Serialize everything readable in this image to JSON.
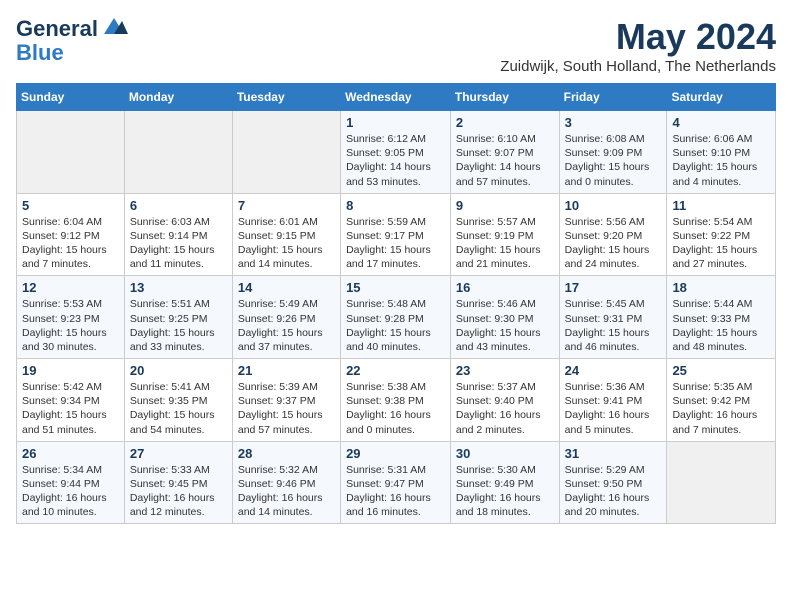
{
  "header": {
    "logo_line1": "General",
    "logo_line2": "Blue",
    "month": "May 2024",
    "location": "Zuidwijk, South Holland, The Netherlands"
  },
  "weekdays": [
    "Sunday",
    "Monday",
    "Tuesday",
    "Wednesday",
    "Thursday",
    "Friday",
    "Saturday"
  ],
  "weeks": [
    [
      {
        "num": "",
        "info": ""
      },
      {
        "num": "",
        "info": ""
      },
      {
        "num": "",
        "info": ""
      },
      {
        "num": "1",
        "info": "Sunrise: 6:12 AM\nSunset: 9:05 PM\nDaylight: 14 hours and 53 minutes."
      },
      {
        "num": "2",
        "info": "Sunrise: 6:10 AM\nSunset: 9:07 PM\nDaylight: 14 hours and 57 minutes."
      },
      {
        "num": "3",
        "info": "Sunrise: 6:08 AM\nSunset: 9:09 PM\nDaylight: 15 hours and 0 minutes."
      },
      {
        "num": "4",
        "info": "Sunrise: 6:06 AM\nSunset: 9:10 PM\nDaylight: 15 hours and 4 minutes."
      }
    ],
    [
      {
        "num": "5",
        "info": "Sunrise: 6:04 AM\nSunset: 9:12 PM\nDaylight: 15 hours and 7 minutes."
      },
      {
        "num": "6",
        "info": "Sunrise: 6:03 AM\nSunset: 9:14 PM\nDaylight: 15 hours and 11 minutes."
      },
      {
        "num": "7",
        "info": "Sunrise: 6:01 AM\nSunset: 9:15 PM\nDaylight: 15 hours and 14 minutes."
      },
      {
        "num": "8",
        "info": "Sunrise: 5:59 AM\nSunset: 9:17 PM\nDaylight: 15 hours and 17 minutes."
      },
      {
        "num": "9",
        "info": "Sunrise: 5:57 AM\nSunset: 9:19 PM\nDaylight: 15 hours and 21 minutes."
      },
      {
        "num": "10",
        "info": "Sunrise: 5:56 AM\nSunset: 9:20 PM\nDaylight: 15 hours and 24 minutes."
      },
      {
        "num": "11",
        "info": "Sunrise: 5:54 AM\nSunset: 9:22 PM\nDaylight: 15 hours and 27 minutes."
      }
    ],
    [
      {
        "num": "12",
        "info": "Sunrise: 5:53 AM\nSunset: 9:23 PM\nDaylight: 15 hours and 30 minutes."
      },
      {
        "num": "13",
        "info": "Sunrise: 5:51 AM\nSunset: 9:25 PM\nDaylight: 15 hours and 33 minutes."
      },
      {
        "num": "14",
        "info": "Sunrise: 5:49 AM\nSunset: 9:26 PM\nDaylight: 15 hours and 37 minutes."
      },
      {
        "num": "15",
        "info": "Sunrise: 5:48 AM\nSunset: 9:28 PM\nDaylight: 15 hours and 40 minutes."
      },
      {
        "num": "16",
        "info": "Sunrise: 5:46 AM\nSunset: 9:30 PM\nDaylight: 15 hours and 43 minutes."
      },
      {
        "num": "17",
        "info": "Sunrise: 5:45 AM\nSunset: 9:31 PM\nDaylight: 15 hours and 46 minutes."
      },
      {
        "num": "18",
        "info": "Sunrise: 5:44 AM\nSunset: 9:33 PM\nDaylight: 15 hours and 48 minutes."
      }
    ],
    [
      {
        "num": "19",
        "info": "Sunrise: 5:42 AM\nSunset: 9:34 PM\nDaylight: 15 hours and 51 minutes."
      },
      {
        "num": "20",
        "info": "Sunrise: 5:41 AM\nSunset: 9:35 PM\nDaylight: 15 hours and 54 minutes."
      },
      {
        "num": "21",
        "info": "Sunrise: 5:39 AM\nSunset: 9:37 PM\nDaylight: 15 hours and 57 minutes."
      },
      {
        "num": "22",
        "info": "Sunrise: 5:38 AM\nSunset: 9:38 PM\nDaylight: 16 hours and 0 minutes."
      },
      {
        "num": "23",
        "info": "Sunrise: 5:37 AM\nSunset: 9:40 PM\nDaylight: 16 hours and 2 minutes."
      },
      {
        "num": "24",
        "info": "Sunrise: 5:36 AM\nSunset: 9:41 PM\nDaylight: 16 hours and 5 minutes."
      },
      {
        "num": "25",
        "info": "Sunrise: 5:35 AM\nSunset: 9:42 PM\nDaylight: 16 hours and 7 minutes."
      }
    ],
    [
      {
        "num": "26",
        "info": "Sunrise: 5:34 AM\nSunset: 9:44 PM\nDaylight: 16 hours and 10 minutes."
      },
      {
        "num": "27",
        "info": "Sunrise: 5:33 AM\nSunset: 9:45 PM\nDaylight: 16 hours and 12 minutes."
      },
      {
        "num": "28",
        "info": "Sunrise: 5:32 AM\nSunset: 9:46 PM\nDaylight: 16 hours and 14 minutes."
      },
      {
        "num": "29",
        "info": "Sunrise: 5:31 AM\nSunset: 9:47 PM\nDaylight: 16 hours and 16 minutes."
      },
      {
        "num": "30",
        "info": "Sunrise: 5:30 AM\nSunset: 9:49 PM\nDaylight: 16 hours and 18 minutes."
      },
      {
        "num": "31",
        "info": "Sunrise: 5:29 AM\nSunset: 9:50 PM\nDaylight: 16 hours and 20 minutes."
      },
      {
        "num": "",
        "info": ""
      }
    ]
  ]
}
